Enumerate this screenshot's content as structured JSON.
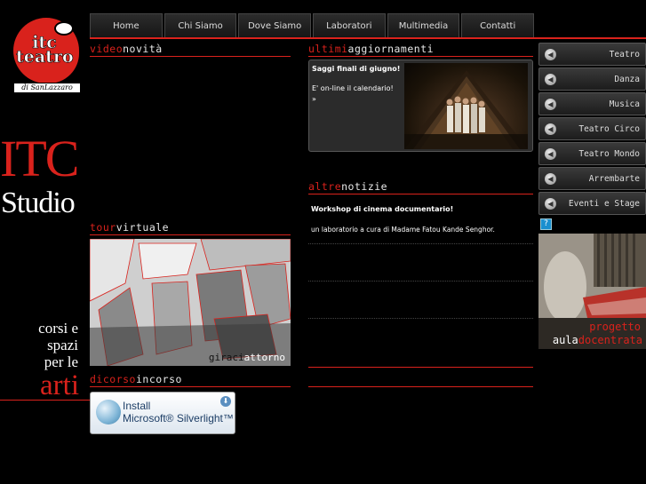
{
  "logo": {
    "line1": "itc",
    "line2": "teatro",
    "sub": "di SanLazzaro"
  },
  "brand": {
    "title": "ITC",
    "subtitle": "Studio"
  },
  "tagline": {
    "line1": "corsi e",
    "line2": "spazi",
    "line3": "per le",
    "accent": "arti"
  },
  "nav": {
    "items": [
      "Home",
      "Chi Siamo",
      "Dove Siamo",
      "Laboratori",
      "Multimedia",
      "Contatti"
    ]
  },
  "sections": {
    "video": {
      "red": "video",
      "white": "novità"
    },
    "latest": {
      "red": "ultimi",
      "white": "aggiornamenti"
    },
    "other": {
      "red": "altre",
      "white": "notizie"
    },
    "tour": {
      "red": "tour",
      "white": "virtuale"
    },
    "ongoing": {
      "red": "dicorso",
      "white": "incorso"
    }
  },
  "latest_item": {
    "headline": "Saggi finali di giugno!",
    "body": "E' on-line il calendario!",
    "more": "»"
  },
  "other_news": {
    "title": "Workshop di cinema documentario!",
    "body": "un laboratorio a cura di Madame Fatou Kande Senghor."
  },
  "tour_caption": {
    "part1": "giraci",
    "part2": "attorno"
  },
  "silverlight": {
    "line1": "Install",
    "line2": "Microsoft® Silverlight™"
  },
  "side_menu": {
    "items": [
      "Teatro",
      "Danza",
      "Musica",
      "Teatro Circo",
      "Teatro Mondo",
      "Arrembarte",
      "Eventi e Stage"
    ]
  },
  "promo": {
    "line1": "progetto",
    "line2a": "aula",
    "line2b": "docentrata"
  },
  "colors": {
    "accent": "#d9221c",
    "background": "#000000"
  }
}
